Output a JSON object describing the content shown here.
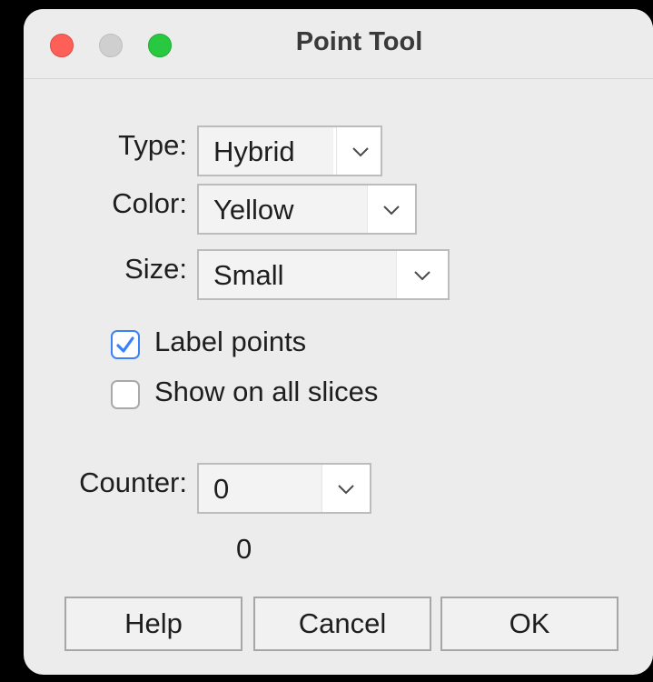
{
  "window": {
    "title": "Point Tool"
  },
  "form": {
    "type": {
      "label": "Type:",
      "value": "Hybrid"
    },
    "color": {
      "label": "Color:",
      "value": "Yellow"
    },
    "size": {
      "label": "Size:",
      "value": "Small"
    },
    "label_points": {
      "label": "Label points",
      "checked": true
    },
    "show_all_slices": {
      "label": "Show on all slices",
      "checked": false
    },
    "counter": {
      "label": "Counter:",
      "value": "0"
    },
    "count_value": "0"
  },
  "buttons": {
    "help": "Help",
    "cancel": "Cancel",
    "ok": "OK"
  },
  "colors": {
    "accent": "#3b82f6",
    "close": "#fe5f57",
    "minimize": "#cfcfcf",
    "zoom": "#28c840"
  },
  "icons": {
    "dropdown": "chevron-down-icon",
    "check": "checkmark-icon"
  }
}
